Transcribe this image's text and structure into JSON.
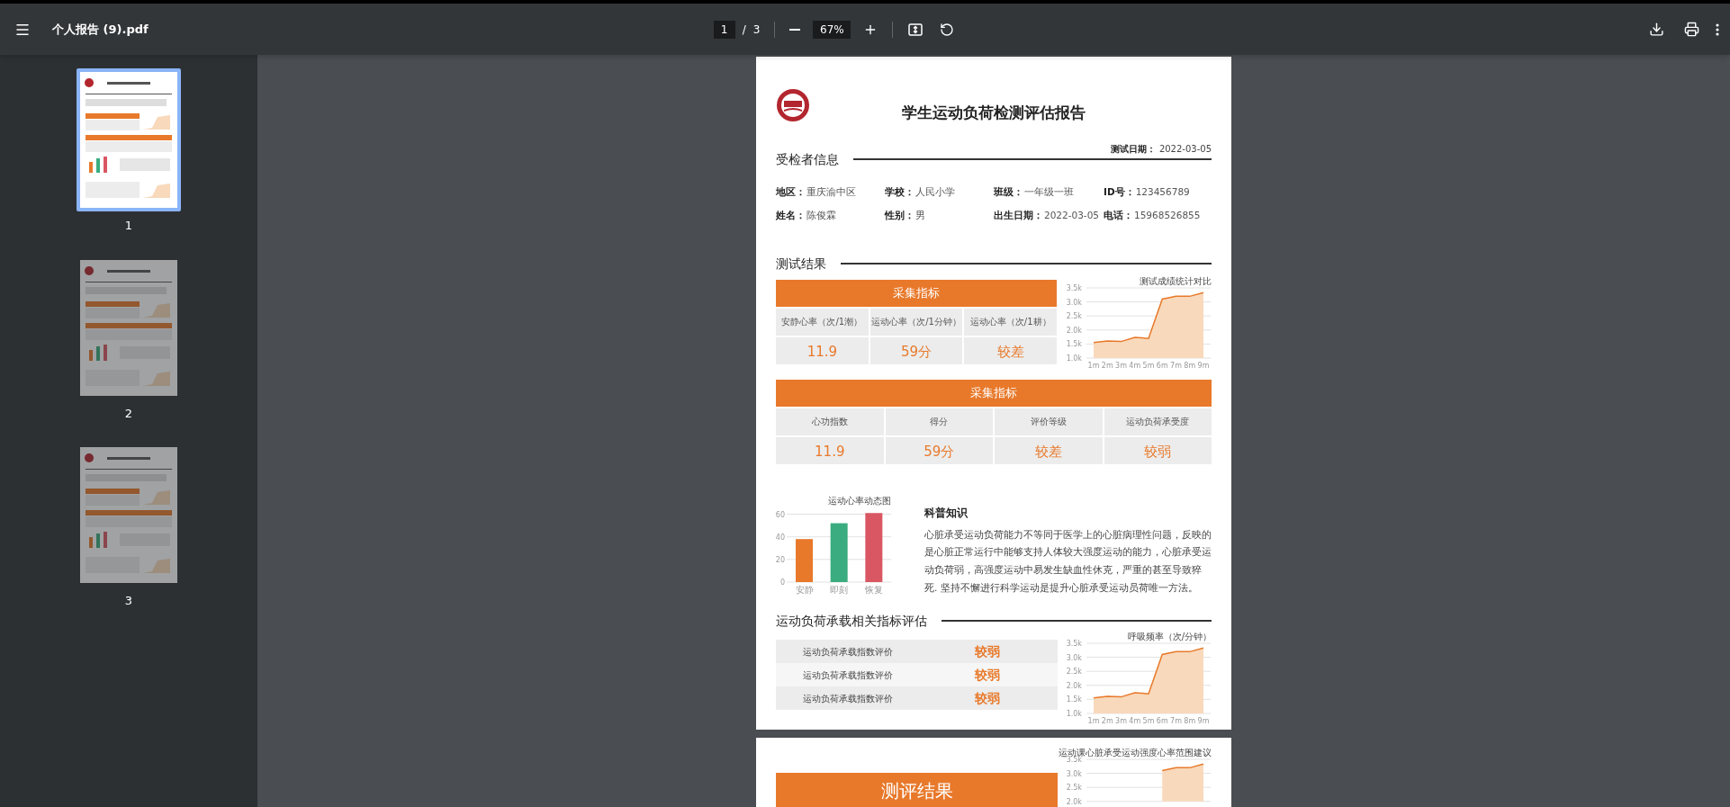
{
  "toolbar": {
    "file_name": "个人报告 (9).pdf",
    "page_number": "1",
    "page_separator": "/",
    "page_count": "3",
    "zoom": "67%"
  },
  "thumbnails": [
    {
      "label": "1",
      "selected": true
    },
    {
      "label": "2",
      "selected": false
    },
    {
      "label": "3",
      "selected": false
    }
  ],
  "report": {
    "title": "学生运动负荷检测评估报告",
    "subject": {
      "heading": "受检者信息",
      "test_date_label": "测试日期：",
      "test_date": "2022-03-05",
      "fields": [
        {
          "label": "地区：",
          "value": "重庆渝中区"
        },
        {
          "label": "学校：",
          "value": "人民小学"
        },
        {
          "label": "班级：",
          "value": "一年级一班"
        },
        {
          "label": "ID号：",
          "value": "123456789"
        },
        {
          "label": "姓名：",
          "value": "陈俊霖"
        },
        {
          "label": "性别：",
          "value": "男"
        },
        {
          "label": "出生日期：",
          "value": "2022-03-05"
        },
        {
          "label": "电话：",
          "value": "15968526855"
        }
      ]
    },
    "results": {
      "heading": "测试结果",
      "table_1": {
        "title": "采集指标",
        "labels": [
          "安静心率（次/1潮）",
          "运动心率（次/1分钟）",
          "运动心率（次/1耕）"
        ],
        "values": [
          "11.9",
          "59分",
          "较差"
        ]
      },
      "chart_1": {
        "chart_data": {
          "type": "area",
          "title": "测试成绩统计对比",
          "grid": true,
          "categories": [
            "1m",
            "2m",
            "3m",
            "4m",
            "5m",
            "6m",
            "7m",
            "8m",
            "9m"
          ],
          "values": [
            1550,
            1610,
            1590,
            1740,
            1700,
            3100,
            3200,
            3200,
            3330
          ],
          "ylim": [
            1000,
            3500
          ],
          "yticks": [
            {
              "value": 1000,
              "label": "1.0k"
            },
            {
              "value": 1500,
              "label": "1.5k"
            },
            {
              "value": 2000,
              "label": "2.0k"
            },
            {
              "value": 2500,
              "label": "2.5k"
            },
            {
              "value": 3000,
              "label": "3.0k"
            },
            {
              "value": 3500,
              "label": "3.5k"
            }
          ]
        }
      },
      "table_2": {
        "title": "采集指标",
        "labels": [
          "心功指数",
          "得分",
          "评价等级",
          "运动负荷承受度"
        ],
        "values": [
          "11.9",
          "59分",
          "较差",
          "较弱"
        ]
      },
      "bar_chart": {
        "chart_data": {
          "type": "bar",
          "title": "运动心率动态图",
          "grid": true,
          "categories": [
            "安静",
            "即刻",
            "恢复"
          ],
          "values": [
            38,
            52,
            61
          ],
          "colors": [
            "#e8792b",
            "#3aac7f",
            "#d95763"
          ],
          "ylim": [
            0,
            62
          ],
          "yticks": [
            0,
            20,
            40,
            60
          ]
        }
      },
      "knowledge": {
        "title": "科普知识",
        "text": "心脏承受运动负荷能力不等同于医学上的心脏病理性问题，反映的是心脏正常运行中能够支持人体较大强度运动的能力，心脏承受运动负荷弱，高强度运动中易发生缺血性休克，严重的甚至导致猝死. 坚持不懈进行科学运动是提升心脏承受运动员荷唯一方法。"
      }
    },
    "evaluation": {
      "heading": "运动负荷承载相关指标评估",
      "rows": [
        {
          "label": "运动负荷承载指数评价",
          "value": "较弱"
        },
        {
          "label": "运动负荷承载指数评价",
          "value": "较弱"
        },
        {
          "label": "运动负荷承载指数评价",
          "value": "较弱"
        }
      ],
      "chart": {
        "chart_data": {
          "type": "area",
          "title": "呼吸频率（次/分钟）",
          "grid": true,
          "categories": [
            "1m",
            "2m",
            "3m",
            "4m",
            "5m",
            "6m",
            "7m",
            "8m",
            "9m"
          ],
          "values": [
            1550,
            1610,
            1590,
            1740,
            1700,
            3100,
            3200,
            3200,
            3330
          ],
          "ylim": [
            1000,
            3500
          ],
          "yticks": [
            {
              "value": 1000,
              "label": "1.0k"
            },
            {
              "value": 1500,
              "label": "1.5k"
            },
            {
              "value": 2000,
              "label": "2.0k"
            },
            {
              "value": 2500,
              "label": "2.5k"
            },
            {
              "value": 3000,
              "label": "3.0k"
            },
            {
              "value": 3500,
              "label": "3.5k"
            }
          ]
        }
      }
    }
  },
  "page_2": {
    "chart": {
      "chart_data": {
        "type": "area",
        "title": "运动课心脏承受运动强度心率范围建议",
        "values": [
          null,
          null,
          null,
          null,
          null,
          3100,
          3200,
          3200,
          3330
        ],
        "grid": true,
        "ylim": [
          2000,
          3500
        ],
        "yticks": [
          {
            "value": 2000,
            "label": "2.0k"
          },
          {
            "value": 2500,
            "label": "2.5k"
          },
          {
            "value": 3000,
            "label": "3.0k"
          },
          {
            "value": 3500,
            "label": "3.5k"
          }
        ]
      }
    },
    "result_title": "测评结果"
  }
}
